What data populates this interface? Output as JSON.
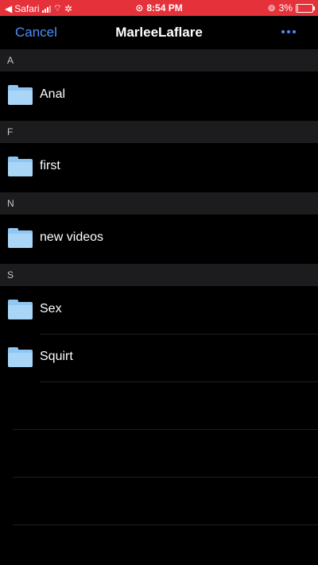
{
  "status_bar": {
    "back_app": "Safari",
    "time": "8:54 PM",
    "battery": "3%",
    "battery_level": 0.03
  },
  "nav": {
    "cancel": "Cancel",
    "title": "MarleeLaflare",
    "more_icon": "ellipsis-icon",
    "accent": "#4c8dff"
  },
  "sections": [
    {
      "letter": "A",
      "items": [
        {
          "label": "Anal",
          "icon": "folder-icon"
        }
      ]
    },
    {
      "letter": "F",
      "items": [
        {
          "label": "first",
          "icon": "folder-icon"
        }
      ]
    },
    {
      "letter": "N",
      "items": [
        {
          "label": "new videos",
          "icon": "folder-icon"
        }
      ]
    },
    {
      "letter": "S",
      "items": [
        {
          "label": "Sex",
          "icon": "folder-icon"
        },
        {
          "label": "Squirt",
          "icon": "folder-icon"
        }
      ]
    }
  ],
  "colors": {
    "status_bar": "#e5323a",
    "background": "#000000",
    "section_header": "#1c1c1e",
    "folder": "#8fc7f2"
  }
}
